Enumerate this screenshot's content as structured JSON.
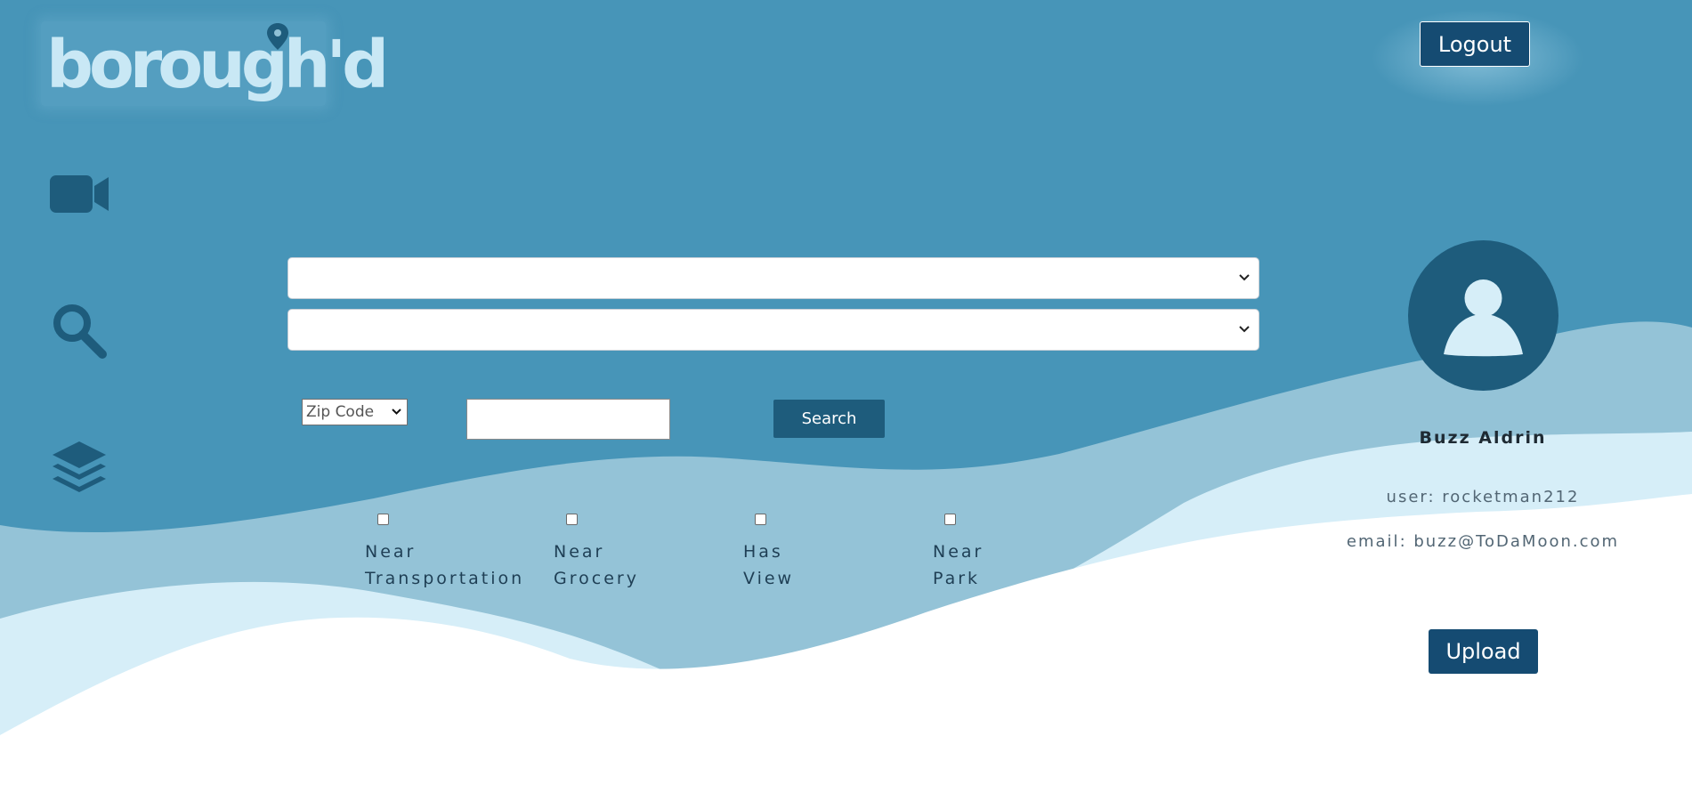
{
  "brand": {
    "logo_text": "borough'd"
  },
  "header": {
    "logout_label": "Logout"
  },
  "sidebar": {
    "icons": [
      "video-camera-icon",
      "search-icon",
      "layers-icon"
    ]
  },
  "search": {
    "dropdown_1_value": "",
    "dropdown_2_value": "",
    "zip_select_value": "Zip Code",
    "text_input_value": "",
    "search_label": "Search"
  },
  "filters": [
    {
      "label_line1": "Near",
      "label_line2": "Transportation",
      "checked": false
    },
    {
      "label_line1": "Near",
      "label_line2": "Grocery",
      "checked": false
    },
    {
      "label_line1": "Has",
      "label_line2": "View",
      "checked": false
    },
    {
      "label_line1": "Near",
      "label_line2": "Park",
      "checked": false
    }
  ],
  "profile": {
    "name": "Buzz Aldrin",
    "user_line": "user: rocketman212",
    "email_line": "email: buzz@ToDaMoon.com",
    "upload_label": "Upload"
  },
  "colors": {
    "background": "#4795b8",
    "wave_mid": "#8fc1d6",
    "wave_light": "#d6eef8",
    "button_dark": "#154b72",
    "icon_dark": "#1e5c7c"
  }
}
